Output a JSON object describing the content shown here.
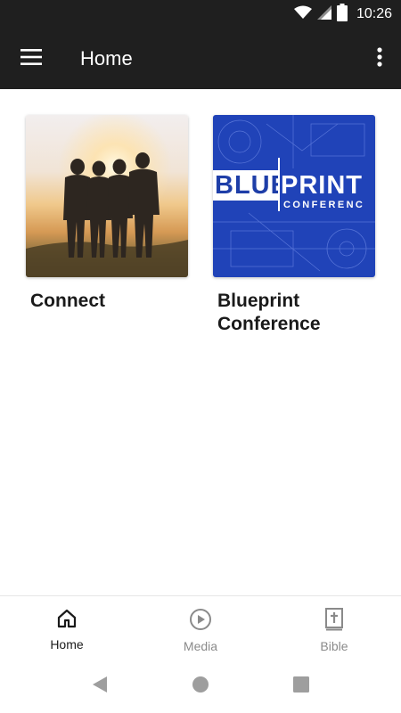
{
  "status_bar": {
    "time": "10:26"
  },
  "app_bar": {
    "title": "Home"
  },
  "cards": [
    {
      "label": "Connect"
    },
    {
      "label": "Blueprint Conference",
      "thumb_left": "BLUE",
      "thumb_right": "PRINT",
      "thumb_sub": "CONFERENC"
    }
  ],
  "bottom_nav": [
    {
      "label": "Home",
      "icon": "home-icon",
      "active": true
    },
    {
      "label": "Media",
      "icon": "play-circle-icon",
      "active": false
    },
    {
      "label": "Bible",
      "icon": "bible-icon",
      "active": false
    }
  ],
  "colors": {
    "app_bar": "#1f1f1f",
    "blueprint_blue": "#2043b8",
    "active": "#1a1a1a",
    "inactive": "#8a8a8a"
  }
}
